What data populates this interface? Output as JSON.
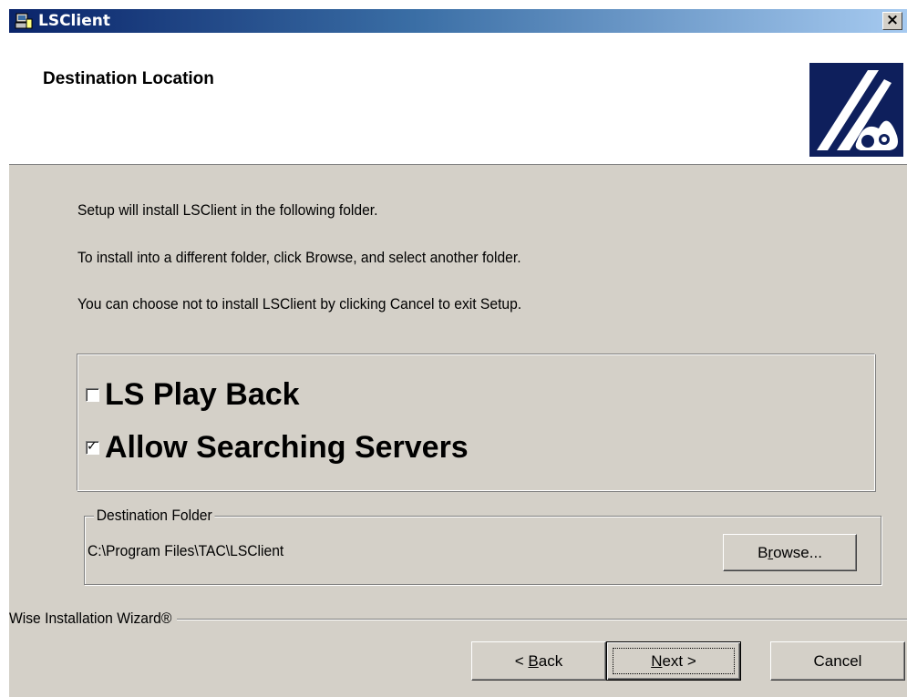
{
  "window": {
    "title": "LSClient",
    "close_symbol": "×"
  },
  "header": {
    "title": "Destination Location",
    "logo_icon": "wise-wizard-logo-icon"
  },
  "body_text": {
    "line1": "Setup will install  LSClient in the following folder.",
    "line2": "To install into a different folder, click Browse, and select another folder.",
    "line3": "You can choose not to install  LSClient by clicking Cancel to exit Setup."
  },
  "options": [
    {
      "label": "LS Play Back",
      "checked": false
    },
    {
      "label": "Allow Searching Servers",
      "checked": true
    }
  ],
  "destination": {
    "legend": "Destination Folder",
    "path": "C:\\Program Files\\TAC\\LSClient",
    "browse_label_pre": "B",
    "browse_label_u": "r",
    "browse_label_post": "owse..."
  },
  "footer": {
    "brand": "Wise Installation Wizard®",
    "back_pre": "< ",
    "back_u": "B",
    "back_post": "ack",
    "next_u": "N",
    "next_post": "ext >",
    "cancel": "Cancel"
  },
  "colors": {
    "dialog_bg": "#d4d0c8",
    "title_start": "#0a246a",
    "title_end": "#a6caf0",
    "logo_bg": "#0e1f5c"
  }
}
